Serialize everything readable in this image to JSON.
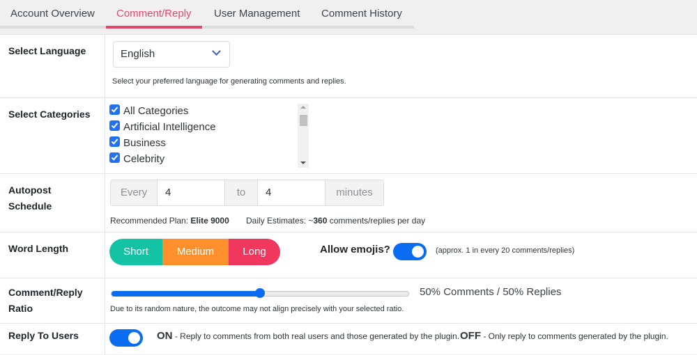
{
  "tabs": [
    {
      "label": "Account Overview",
      "active": false
    },
    {
      "label": "Comment/Reply",
      "active": true
    },
    {
      "label": "User Management",
      "active": false
    },
    {
      "label": "Comment History",
      "active": false
    }
  ],
  "colors": {
    "accent": "#e7476a",
    "primary": "#0a6cf0",
    "short": "#14c3a4",
    "medium": "#fd8f2c",
    "long": "#f0385e"
  },
  "language": {
    "label": "Select Language",
    "selected": "English",
    "help": "Select your preferred language for generating comments and replies."
  },
  "categories": {
    "label": "Select Categories",
    "items": [
      {
        "label": "All Categories",
        "checked": true
      },
      {
        "label": "Artificial Intelligence",
        "checked": true
      },
      {
        "label": "Business",
        "checked": true
      },
      {
        "label": "Celebrity",
        "checked": true
      }
    ]
  },
  "schedule": {
    "label": "Autopost Schedule",
    "prefix": "Every",
    "from_value": "4",
    "middle": "to",
    "to_value": "4",
    "suffix": "minutes",
    "plan_label": "Recommended Plan:",
    "plan_value": "Elite 9000",
    "estimate_label": "Daily Estimates: ~",
    "estimate_value": "360",
    "estimate_suffix": " comments/replies per day"
  },
  "word_length": {
    "label": "Word Length",
    "options": [
      "Short",
      "Medium",
      "Long"
    ],
    "emoji_label": "Allow emojis?",
    "emoji_enabled": true,
    "emoji_note": "(approx. 1 in every 20 comments/replies)"
  },
  "ratio": {
    "label": "Comment/Reply Ratio",
    "value_percent": 50,
    "text": "50% Comments / 50% Replies",
    "help": "Due to its random nature, the outcome may not align precisely with your selected ratio."
  },
  "reply_users": {
    "label": "Reply To Users",
    "enabled": true,
    "on_label": "ON",
    "on_desc": " - Reply to comments from both real users and those generated by the plugin.",
    "off_label": "OFF",
    "off_desc": " - Only reply to comments generated by the plugin."
  }
}
